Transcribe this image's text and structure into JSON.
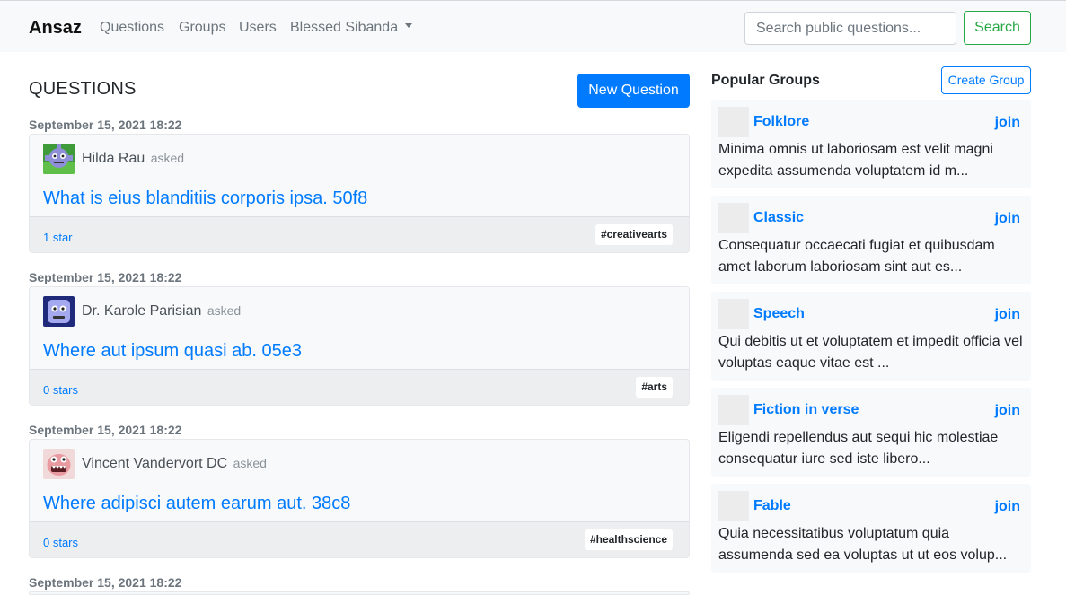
{
  "navbar": {
    "brand": "Ansaz",
    "links": [
      "Questions",
      "Groups",
      "Users"
    ],
    "user": "Blessed Sibanda",
    "search_placeholder": "Search public questions...",
    "search_label": "Search"
  },
  "main": {
    "title": "QUESTIONS",
    "new_question_label": "New Question",
    "questions": [
      {
        "date": "September 15, 2021 18:22",
        "asker": "Hilda Rau",
        "asked": "asked",
        "title": "What is eius blanditiis corporis ipsa. 50f8",
        "stars": "1 star",
        "tag": "#creativearts"
      },
      {
        "date": "September 15, 2021 18:22",
        "asker": "Dr. Karole Parisian",
        "asked": "asked",
        "title": "Where aut ipsum quasi ab. 05e3",
        "stars": "0 stars",
        "tag": "#arts"
      },
      {
        "date": "September 15, 2021 18:22",
        "asker": "Vincent Vandervort DC",
        "asked": "asked",
        "title": "Where adipisci autem earum aut. 38c8",
        "stars": "0 stars",
        "tag": "#healthscience"
      },
      {
        "date": "September 15, 2021 18:22"
      }
    ]
  },
  "sidebar": {
    "title": "Popular Groups",
    "create_label": "Create Group",
    "join_label": "join",
    "groups": [
      {
        "name": "Folklore",
        "desc": "Minima omnis ut laboriosam est velit magni expedita assumenda voluptatem id m..."
      },
      {
        "name": "Classic",
        "desc": "Consequatur occaecati fugiat et quibusdam amet laborum laboriosam sint aut es..."
      },
      {
        "name": "Speech",
        "desc": "Qui debitis ut et voluptatem et impedit officia vel voluptas eaque vitae est ..."
      },
      {
        "name": "Fiction in verse",
        "desc": "Eligendi repellendus aut sequi hic molestiae consequatur iure sed iste libero..."
      },
      {
        "name": "Fable",
        "desc": "Quia necessitatibus voluptatum quia assumenda sed ea voluptas ut ut eos volup..."
      }
    ]
  },
  "colors": {
    "primary": "#007bff",
    "success": "#28a745",
    "muted": "#6c757d",
    "navbar_bg": "#f8f9fa"
  },
  "icons": {
    "avatars": [
      "robot-avatar-green",
      "robot-avatar-blue",
      "robot-avatar-pink"
    ],
    "caret": "caret-down-icon"
  }
}
